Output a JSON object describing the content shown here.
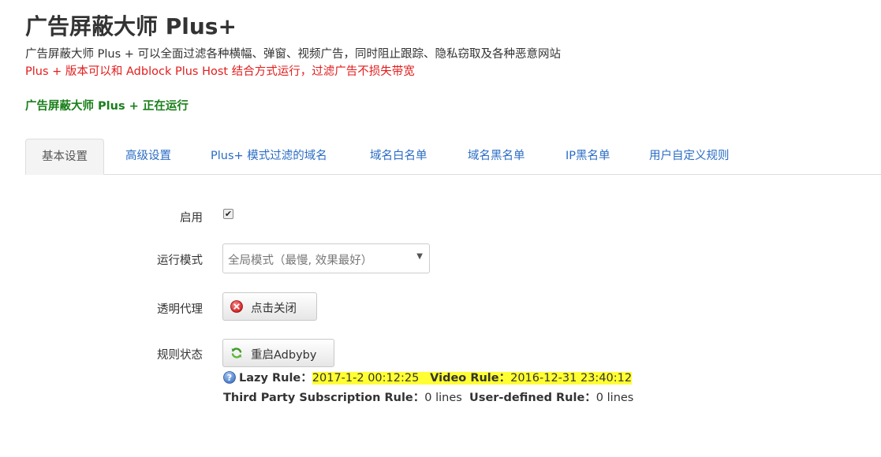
{
  "header": {
    "title": "广告屏蔽大师 Plus+",
    "description": "广告屏蔽大师 Plus + 可以全面过滤各种横幅、弹窗、视频广告，同时阻止跟踪、隐私窃取及各种恶意网站",
    "note": "Plus + 版本可以和 Adblock Plus Host 结合方式运行，过滤广告不损失带宽",
    "status": "广告屏蔽大师 Plus + 正在运行"
  },
  "tabs": [
    {
      "label": "基本设置",
      "active": true
    },
    {
      "label": "高级设置",
      "active": false
    },
    {
      "label": "Plus+ 模式过滤的域名",
      "active": false
    },
    {
      "label": "域名白名单",
      "active": false
    },
    {
      "label": "域名黑名单",
      "active": false
    },
    {
      "label": "IP黑名单",
      "active": false
    },
    {
      "label": "用户自定义规则",
      "active": false
    }
  ],
  "form": {
    "enable_label": "启用",
    "enable_checked": true,
    "mode_label": "运行模式",
    "mode_value": "全局模式（最慢, 效果最好）",
    "proxy_label": "透明代理",
    "proxy_button": "点击关闭",
    "rules_label": "规则状态",
    "restart_button": "重启Adbyby"
  },
  "rules": {
    "lazy_label": "Lazy Rule：",
    "lazy_value": "2017-1-2 00:12:25",
    "video_label": "Video Rule：",
    "video_value": "2016-12-31 23:40:12",
    "third_label": "Third Party Subscription Rule：",
    "third_value": "0 lines",
    "user_label": "User-defined Rule：",
    "user_value": "0 lines"
  },
  "icons": {
    "close": "close-circle-icon",
    "refresh": "refresh-icon",
    "help": "help-icon"
  },
  "colors": {
    "link": "#2a6cc5",
    "warning": "#e21c1c",
    "running": "#1a7f1a",
    "highlight": "#ffff33"
  }
}
